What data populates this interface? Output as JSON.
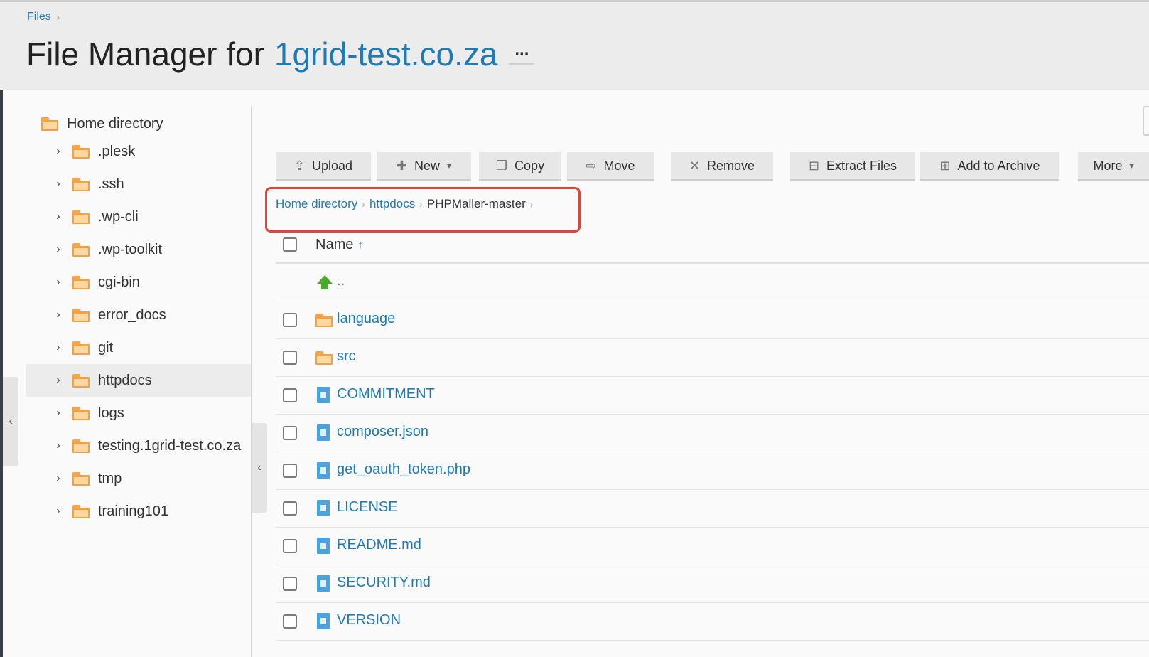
{
  "header": {
    "breadcrumb": "Files",
    "title_prefix": "File Manager for",
    "domain": "1grid-test.co.za",
    "more_label": "..."
  },
  "sidebar": {
    "root_label": "Home directory",
    "items": [
      {
        "label": ".plesk"
      },
      {
        "label": ".ssh"
      },
      {
        "label": ".wp-cli"
      },
      {
        "label": ".wp-toolkit"
      },
      {
        "label": "cgi-bin"
      },
      {
        "label": "error_docs"
      },
      {
        "label": "git"
      },
      {
        "label": "httpdocs",
        "selected": true
      },
      {
        "label": "logs"
      },
      {
        "label": "testing.1grid-test.co.za"
      },
      {
        "label": "tmp"
      },
      {
        "label": "training101"
      }
    ]
  },
  "toolbar": {
    "upload": "Upload",
    "new": "New",
    "copy": "Copy",
    "move": "Move",
    "remove": "Remove",
    "extract": "Extract Files",
    "archive": "Add to Archive",
    "more": "More"
  },
  "path": {
    "home": "Home directory",
    "parent": "httpdocs",
    "current": "PHPMailer-master"
  },
  "list": {
    "name_header": "Name",
    "parent_link": "..",
    "rows": [
      {
        "name": "language",
        "type": "folder"
      },
      {
        "name": "src",
        "type": "folder"
      },
      {
        "name": "COMMITMENT",
        "type": "file"
      },
      {
        "name": "composer.json",
        "type": "file"
      },
      {
        "name": "get_oauth_token.php",
        "type": "file"
      },
      {
        "name": "LICENSE",
        "type": "file"
      },
      {
        "name": "README.md",
        "type": "file"
      },
      {
        "name": "SECURITY.md",
        "type": "file"
      },
      {
        "name": "VERSION",
        "type": "file"
      }
    ]
  },
  "colors": {
    "link": "#1f7bb6",
    "folder": "#f4a142",
    "file": "#4aa3e0",
    "highlight_box": "#d9473a"
  }
}
